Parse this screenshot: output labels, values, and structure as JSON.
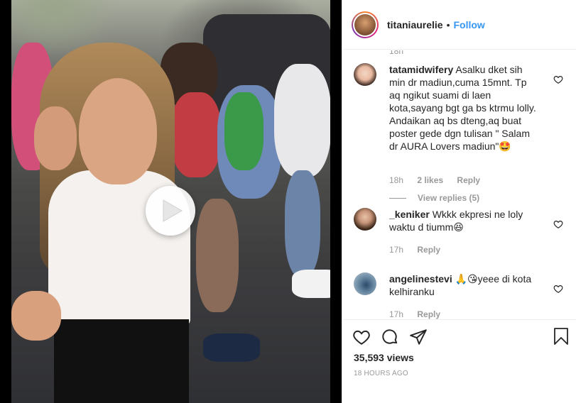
{
  "post": {
    "username": "titaniaurelie",
    "separator": "•",
    "follow_label": "Follow"
  },
  "comments": {
    "cutoff_top_text": "18h",
    "items": [
      {
        "username": "tatamidwifery",
        "text": "Asalku dket sih min dr madiun,cuma 15mnt. Tp aq ngikut suami di laen kota,sayang bgt ga bs ktrmu lolly. Andaikan aq bs dteng,aq buat poster gede dgn tulisan \" Salam dr AURA Lovers madiun\"🤩",
        "time": "18h",
        "likes": "2 likes",
        "reply": "Reply",
        "view_replies": "View replies (5)"
      },
      {
        "username": "_keniker",
        "text": "Wkkk ekpresi ne loly waktu d tiumm😆",
        "time": "17h",
        "reply": "Reply"
      },
      {
        "username": "angelinestevi",
        "text": "🙏😘yeee di kota kelhiranku",
        "time": "17h",
        "reply": "Reply"
      }
    ]
  },
  "stats": {
    "views": "35,593 views",
    "time_ago": "18 HOURS AGO"
  },
  "icons": {
    "like": "heart-icon",
    "comment": "comment-icon",
    "share": "share-icon",
    "save": "bookmark-icon",
    "play": "play-icon"
  },
  "colors": {
    "follow": "#3897f0",
    "text": "#262626",
    "muted": "#999999"
  }
}
